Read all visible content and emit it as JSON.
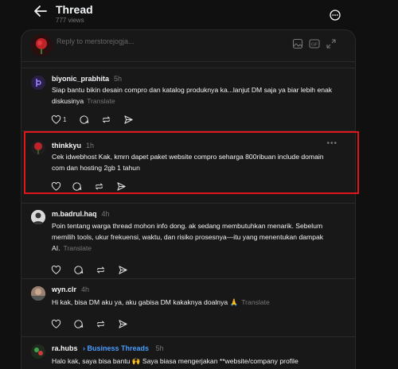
{
  "header": {
    "title": "Thread",
    "views": "777 views"
  },
  "composer": {
    "placeholder": "Reply to merstorejogja..."
  },
  "posts": [
    {
      "username": "biyonic_prabhita",
      "time": "5h",
      "text": "Siap bantu bikin desain compro dan katalog produknya ka...lanjut DM saja ya biar lebih enak diskusinya",
      "translate": "Translate",
      "likes": "1"
    },
    {
      "username": "thinkkyu",
      "time": "1h",
      "text": "Cek idwebhost Kak, kmrn dapet paket website compro seharga 800ribuan include domain com dan hosting 2gb 1 tahun",
      "translate": ""
    },
    {
      "username": "m.badrul.haq",
      "time": "4h",
      "text": "Poin tentang warga thread mohon info dong. ak sedang membutuhkan menarik. Sebelum memilih tools, ukur frekuensi, waktu, dan risiko prosesnya—itu yang menentukan dampak AI.",
      "translate": "Translate"
    },
    {
      "username": "wyn.clr",
      "time": "4h",
      "text": "Hi kak, bisa DM aku ya, aku gabisa DM kakaknya doalnya 🙏",
      "translate": "Translate"
    },
    {
      "username": "ra.hubs",
      "badge": "Business Threads",
      "time": "5h",
      "text": "Halo kak, saya bisa bantu 🙌 Saya biasa mengerjakan **website/company profile",
      "translate": ""
    }
  ],
  "colors": {
    "background": "#101010",
    "panel": "#181818",
    "highlight": "#e0161a",
    "verified": "#4a9cff"
  }
}
